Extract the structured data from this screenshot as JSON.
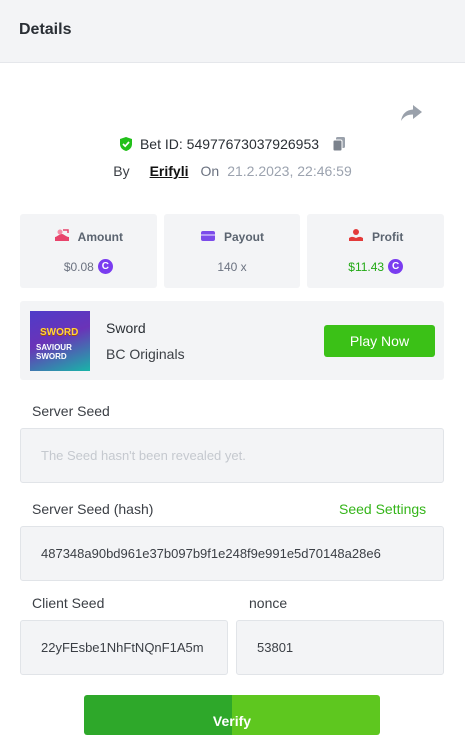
{
  "header": {
    "title": "Details"
  },
  "bet": {
    "id_label": "Bet ID: 54977673037926953",
    "by_label": "By",
    "username": "Erifyli",
    "on_label": "On",
    "datetime": "21.2.2023, 22:46:59"
  },
  "stats": {
    "amount": {
      "label": "Amount",
      "value": "$0.08"
    },
    "payout": {
      "label": "Payout",
      "value": "140 x"
    },
    "profit": {
      "label": "Profit",
      "value": "$11.43"
    },
    "coin_glyph": "C"
  },
  "game": {
    "name": "Sword",
    "provider": "BC Originals",
    "play_label": "Play Now",
    "thumb_title": "SWORD",
    "thumb_subtitle_1": "SAVIOUR",
    "thumb_subtitle_2": "SWORD"
  },
  "seeds": {
    "server_seed_label": "Server Seed",
    "server_seed_placeholder": "The Seed hasn't been revealed yet.",
    "server_seed_hash_label": "Server Seed (hash)",
    "seed_settings_label": "Seed Settings",
    "server_seed_hash": "487348a90bd961e37b097b9f1e248f9e991e5d70148a28e6",
    "client_seed_label": "Client Seed",
    "client_seed": "22yFEsbe1NhFtNQnF1A5m",
    "nonce_label": "nonce",
    "nonce": "53801"
  },
  "actions": {
    "verify_label": "Verify"
  },
  "colors": {
    "accent_green": "#3bc117",
    "profit_green": "#22a915",
    "coin_purple": "#7a3cf0",
    "amount_icon": "#e8436b",
    "payout_icon": "#7c4bea",
    "profit_icon": "#e33a3a"
  },
  "icons": {
    "share": "share-icon",
    "shield": "shield-check-icon",
    "copy": "copy-icon",
    "amount": "amount-icon",
    "payout": "wallet-icon",
    "profit": "profit-icon"
  }
}
